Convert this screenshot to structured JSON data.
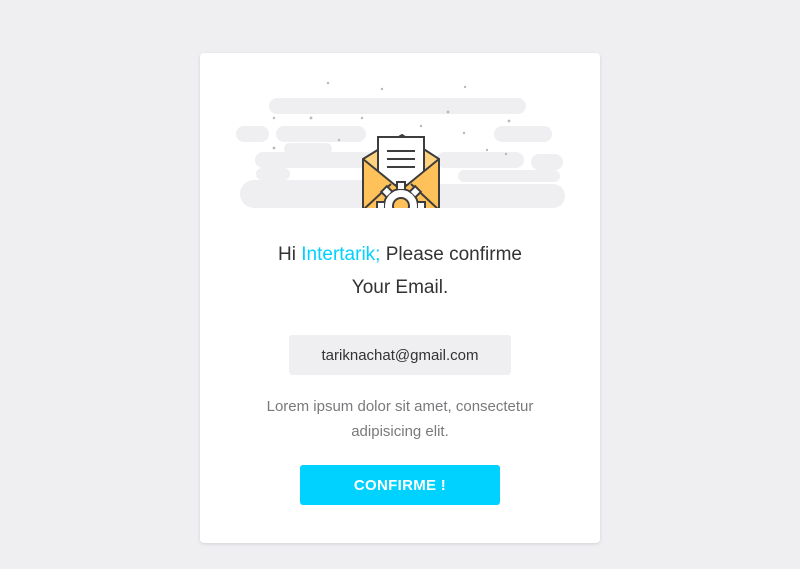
{
  "colors": {
    "background": "#efeef1",
    "card": "#ffffff",
    "accent": "#00d2ff",
    "text": "#333333",
    "muted_text": "#7a7a7e",
    "envelope_fill": "#ffd27f",
    "envelope_stroke": "#3d3d3d"
  },
  "illustration": {
    "icon": "envelope-gear-icon"
  },
  "headline": {
    "greeting": "Hi",
    "name": "Intertarik;",
    "message": "Please confirme",
    "line2": "Your Email."
  },
  "email": {
    "value": "tariknachat@gmail.com"
  },
  "description": {
    "text": "Lorem ipsum dolor sit amet, consectetur adipisicing elit."
  },
  "confirm_button": {
    "label": "CONFIRME !"
  }
}
